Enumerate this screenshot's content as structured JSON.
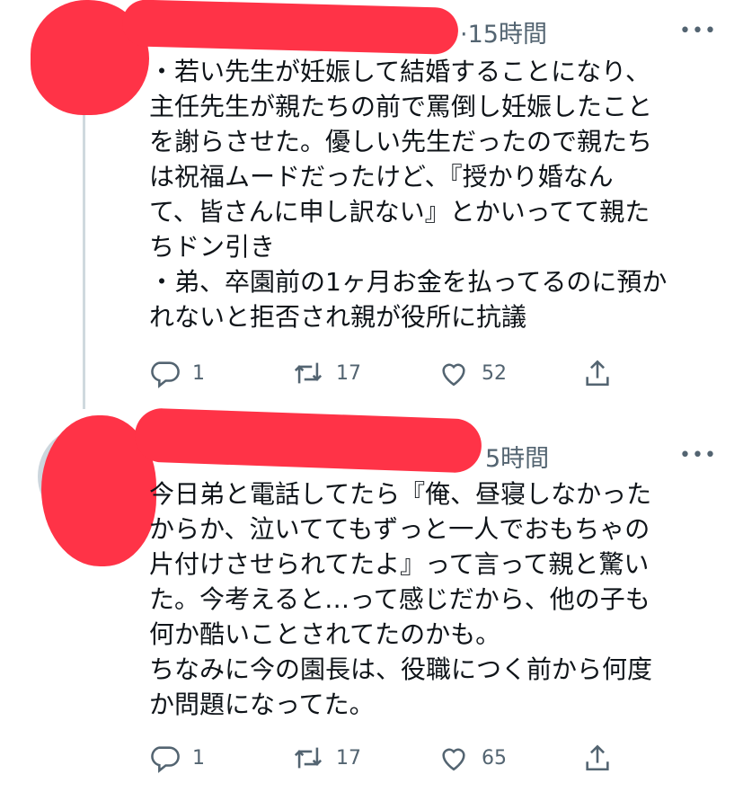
{
  "tweets": [
    {
      "time": "·15時間",
      "more": "•••",
      "lines": [
        "・若い先生が妊娠して結婚することになり、",
        "主任先生が親たちの前で罵倒し妊娠したこと",
        "を謝らさせた。優しい先生だったので親たち",
        "は祝福ムードだったけど、『授かり婚なん",
        "て、皆さんに申し訳ない』とかいってて親た",
        "ちドン引き",
        "・弟、卒園前の1ヶ月お金を払ってるのに預か",
        "れないと拒否され親が役所に抗議"
      ],
      "replies": "1",
      "retweets": "17",
      "likes": "52"
    },
    {
      "time": "5時間",
      "more": "•••",
      "lines": [
        "今日弟と電話してたら『俺、昼寝しなかった",
        "からか、泣いててもずっと一人でおもちゃの",
        "片付けさせられてたよ』って言って親と驚い",
        "た。今考えると…って感じだから、他の子も",
        "何か酷いことされてたのかも。",
        "ちなみに今の園長は、役職につく前から何度",
        "か問題になってた。"
      ],
      "replies": "1",
      "retweets": "17",
      "likes": "65"
    }
  ],
  "colors": {
    "redaction": "#ff3347",
    "muted": "#536471",
    "text": "#0f1419"
  },
  "icons": [
    "reply-icon",
    "retweet-icon",
    "like-icon",
    "share-icon",
    "more-icon"
  ]
}
